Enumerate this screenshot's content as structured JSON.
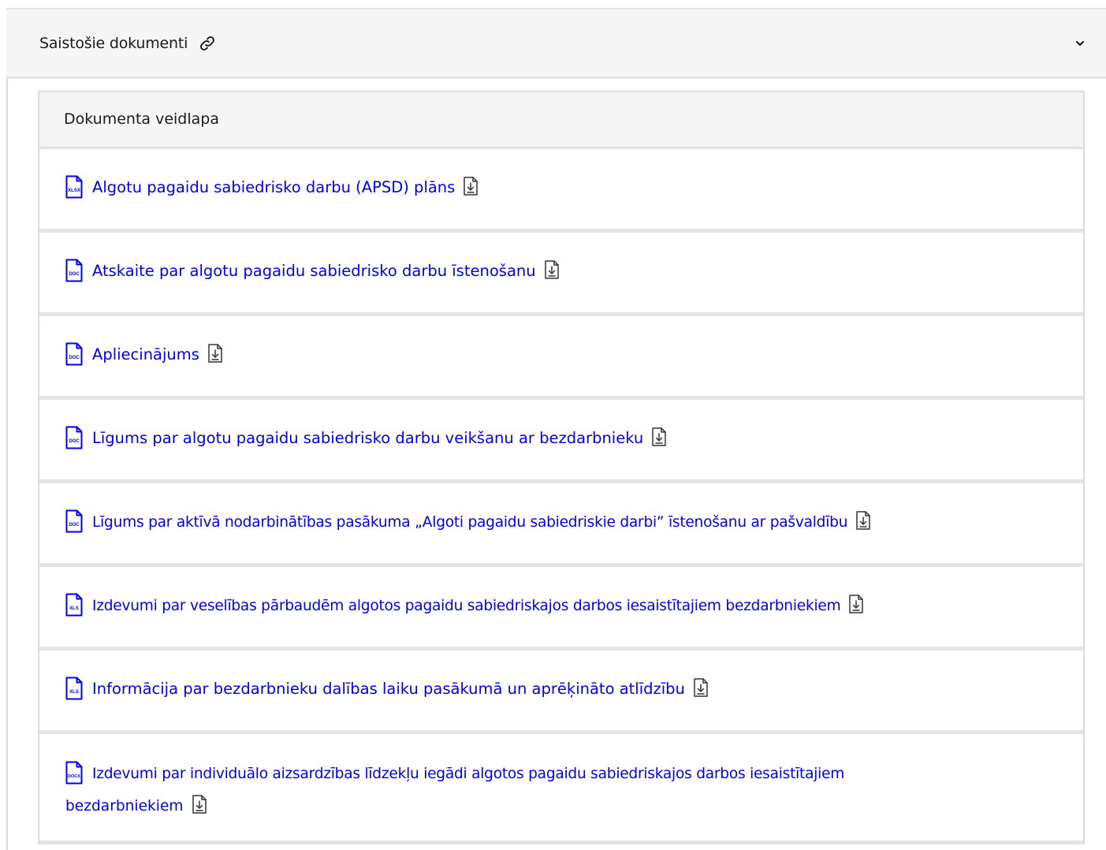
{
  "accordion": {
    "title": "Saistošie dokumenti",
    "expanded": true
  },
  "table": {
    "header": "Dokumenta veidlapa",
    "rows": [
      {
        "label": "Algotu pagaidu sabiedrisko darbu (APSD) plāns",
        "type": "XLSX"
      },
      {
        "label": "Atskaite par algotu pagaidu sabiedrisko darbu īstenošanu",
        "type": "DOC"
      },
      {
        "label": "Apliecinājums",
        "type": "DOC"
      },
      {
        "label": "Līgums par algotu pagaidu sabiedrisko darbu veikšanu ar bezdarbnieku",
        "type": "DOC"
      },
      {
        "label": "Līgums par aktīvā nodarbinātības pasākuma „Algoti pagaidu sabiedriskie darbi” īstenošanu ar pašvaldību",
        "type": "DOC"
      },
      {
        "label": "Izdevumi par veselības pārbaudēm algotos pagaidu sabiedriskajos darbos iesaistītajiem bezdarbniekiem",
        "type": "XLS"
      },
      {
        "label": "Informācija par bezdarbnieku dalības laiku pasākumā un aprēķināto atlīdzību",
        "type": "XLS"
      },
      {
        "label": "Izdevumi par individuālo aizsardzības līdzekļu iegādi algotos pagaidu sabiedriskajos darbos iesaistītajiem",
        "type": "DOCX"
      }
    ],
    "row8_line2": "bezdarbniekiem"
  },
  "colors": {
    "link": "#0000e6",
    "header_bg": "#f5f5f5",
    "border": "#e4e4e4"
  },
  "icons": {
    "accordion": "link-icon",
    "toggle": "chevron-down-icon",
    "file": "file-icon",
    "download": "download-icon"
  }
}
